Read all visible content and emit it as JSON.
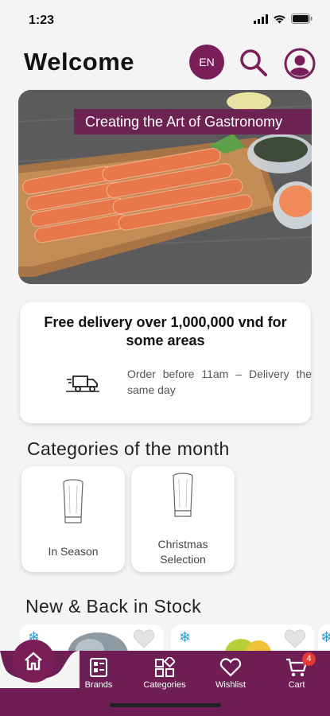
{
  "status_bar": {
    "time": "1:23"
  },
  "header": {
    "title": "Welcome",
    "language": "EN",
    "icons": [
      "search-icon",
      "user-profile-icon"
    ]
  },
  "hero": {
    "banner_text": "Creating the Art of Gastronomy"
  },
  "delivery": {
    "headline": "Free delivery over 1,000,000 vnd for some areas",
    "note": "Order before 11am – Delivery the same day",
    "icon": "delivery-truck-icon"
  },
  "categories": {
    "title": "Categories of the month",
    "items": [
      {
        "label": "In Season",
        "icon": "chef-hat-icon"
      },
      {
        "label": "Christmas Selection",
        "icon": "chef-hat-icon"
      }
    ]
  },
  "new_stock": {
    "title": "New & Back in Stock"
  },
  "nav": {
    "items": [
      {
        "label": "Brands",
        "icon": "brands-icon"
      },
      {
        "label": "Categories",
        "icon": "categories-icon"
      },
      {
        "label": "Wishlist",
        "icon": "heart-icon"
      },
      {
        "label": "Cart",
        "icon": "cart-icon"
      }
    ],
    "cart_count": "4"
  },
  "colors": {
    "brand": "#7a1e5a",
    "nav_bg": "#6e1e55",
    "badge": "#e53935",
    "frozen": "#2b9bd6"
  }
}
